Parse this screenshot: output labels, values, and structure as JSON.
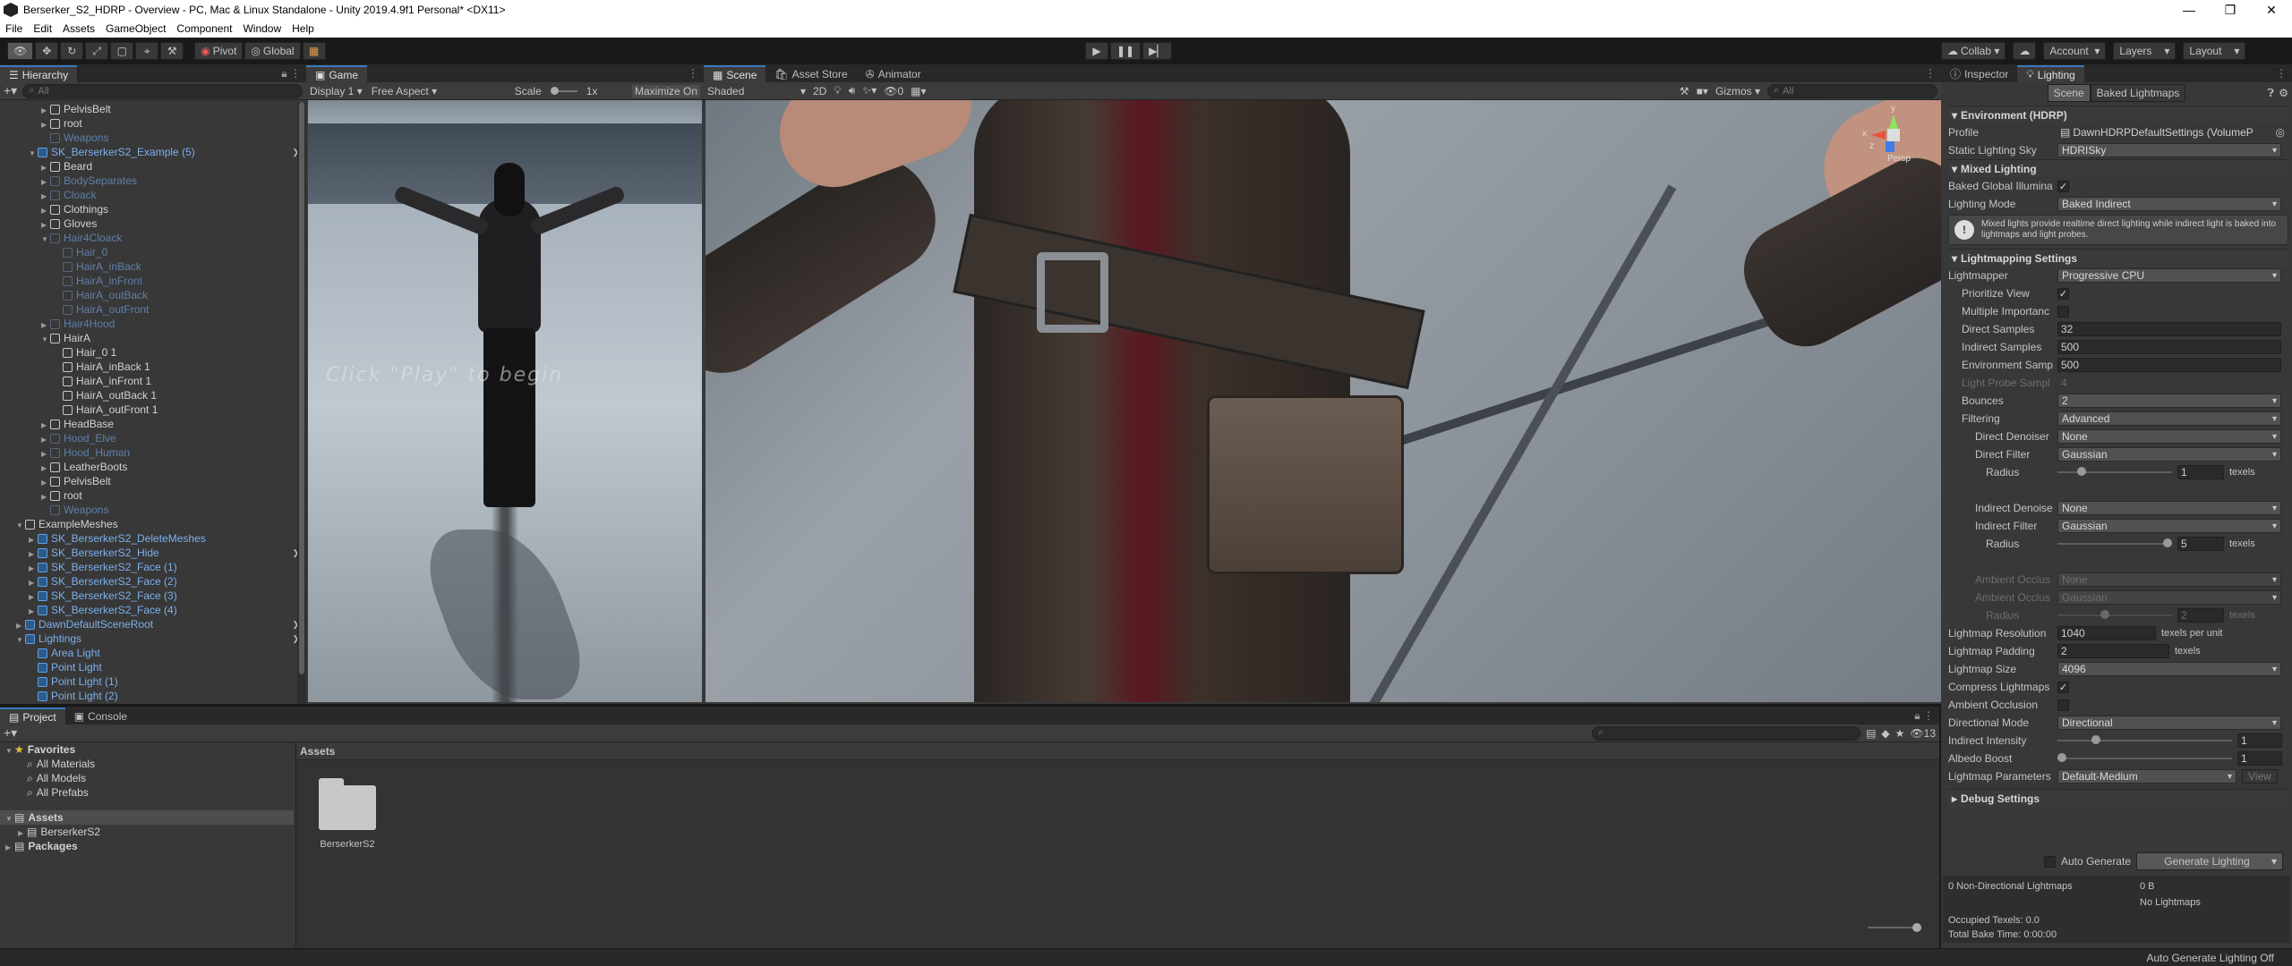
{
  "window": {
    "title": "Berserker_S2_HDRP - Overview - PC, Mac & Linux Standalone - Unity 2019.4.9f1 Personal* <DX11>",
    "controls": [
      "—",
      "❐",
      "✕"
    ]
  },
  "menu": [
    "File",
    "Edit",
    "Assets",
    "GameObject",
    "Component",
    "Window",
    "Help"
  ],
  "toolbar": {
    "pivot": "Pivot",
    "global": "Global",
    "collab": "Collab",
    "account": "Account",
    "layers": "Layers",
    "layout": "Layout"
  },
  "hierarchy": {
    "tab": "Hierarchy",
    "search_placeholder": "All",
    "rows": [
      {
        "label": "PelvisBelt",
        "indent": 4,
        "style": "",
        "arrow": "▶"
      },
      {
        "label": "root",
        "indent": 4,
        "style": "",
        "arrow": "▶"
      },
      {
        "label": "Weapons",
        "indent": 4,
        "style": "dim",
        "arrow": ""
      },
      {
        "label": "SK_BerserkerS2_Example (5)",
        "indent": 3,
        "style": "blue",
        "arrow": "▼",
        "more": true
      },
      {
        "label": "Beard",
        "indent": 4,
        "style": "",
        "arrow": "▶"
      },
      {
        "label": "BodySeparates",
        "indent": 4,
        "style": "dim",
        "arrow": "▶"
      },
      {
        "label": "Cloack",
        "indent": 4,
        "style": "dim",
        "arrow": "▶"
      },
      {
        "label": "Clothings",
        "indent": 4,
        "style": "",
        "arrow": "▶"
      },
      {
        "label": "Gloves",
        "indent": 4,
        "style": "",
        "arrow": "▶"
      },
      {
        "label": "Hair4Cloack",
        "indent": 4,
        "style": "dim",
        "arrow": "▼"
      },
      {
        "label": "Hair_0",
        "indent": 5,
        "style": "dim",
        "arrow": ""
      },
      {
        "label": "HairA_inBack",
        "indent": 5,
        "style": "dim",
        "arrow": ""
      },
      {
        "label": "HairA_inFront",
        "indent": 5,
        "style": "dim",
        "arrow": ""
      },
      {
        "label": "HairA_outBack",
        "indent": 5,
        "style": "dim",
        "arrow": ""
      },
      {
        "label": "HairA_outFront",
        "indent": 5,
        "style": "dim",
        "arrow": ""
      },
      {
        "label": "Hair4Hood",
        "indent": 4,
        "style": "dim",
        "arrow": "▶"
      },
      {
        "label": "HairA",
        "indent": 4,
        "style": "",
        "arrow": "▼"
      },
      {
        "label": "Hair_0 1",
        "indent": 5,
        "style": "",
        "arrow": ""
      },
      {
        "label": "HairA_inBack 1",
        "indent": 5,
        "style": "",
        "arrow": ""
      },
      {
        "label": "HairA_inFront 1",
        "indent": 5,
        "style": "",
        "arrow": ""
      },
      {
        "label": "HairA_outBack 1",
        "indent": 5,
        "style": "",
        "arrow": ""
      },
      {
        "label": "HairA_outFront 1",
        "indent": 5,
        "style": "",
        "arrow": ""
      },
      {
        "label": "HeadBase",
        "indent": 4,
        "style": "",
        "arrow": "▶"
      },
      {
        "label": "Hood_Elve",
        "indent": 4,
        "style": "dim",
        "arrow": "▶"
      },
      {
        "label": "Hood_Human",
        "indent": 4,
        "style": "dim",
        "arrow": "▶"
      },
      {
        "label": "LeatherBoots",
        "indent": 4,
        "style": "",
        "arrow": "▶"
      },
      {
        "label": "PelvisBelt",
        "indent": 4,
        "style": "",
        "arrow": "▶"
      },
      {
        "label": "root",
        "indent": 4,
        "style": "",
        "arrow": "▶"
      },
      {
        "label": "Weapons",
        "indent": 4,
        "style": "dim",
        "arrow": ""
      },
      {
        "label": "ExampleMeshes",
        "indent": 2,
        "style": "",
        "arrow": "▼"
      },
      {
        "label": "SK_BerserkerS2_DeleteMeshes",
        "indent": 3,
        "style": "blue",
        "arrow": "▶"
      },
      {
        "label": "SK_BerserkerS2_Hide",
        "indent": 3,
        "style": "blue",
        "arrow": "▶",
        "more": true
      },
      {
        "label": "SK_BerserkerS2_Face (1)",
        "indent": 3,
        "style": "blue",
        "arrow": "▶"
      },
      {
        "label": "SK_BerserkerS2_Face (2)",
        "indent": 3,
        "style": "blue",
        "arrow": "▶"
      },
      {
        "label": "SK_BerserkerS2_Face (3)",
        "indent": 3,
        "style": "blue",
        "arrow": "▶"
      },
      {
        "label": "SK_BerserkerS2_Face (4)",
        "indent": 3,
        "style": "blue",
        "arrow": "▶"
      },
      {
        "label": "DawnDefaultSceneRoot",
        "indent": 2,
        "style": "blue",
        "arrow": "▶",
        "more": true
      },
      {
        "label": "Lightings",
        "indent": 2,
        "style": "blue",
        "arrow": "▼",
        "more": true
      },
      {
        "label": "Area Light",
        "indent": 3,
        "style": "blue",
        "arrow": ""
      },
      {
        "label": "Point Light",
        "indent": 3,
        "style": "blue",
        "arrow": ""
      },
      {
        "label": "Point Light (1)",
        "indent": 3,
        "style": "blue",
        "arrow": ""
      },
      {
        "label": "Point Light (2)",
        "indent": 3,
        "style": "blue",
        "arrow": ""
      }
    ]
  },
  "game": {
    "tab": "Game",
    "display": "Display 1",
    "aspect": "Free Aspect",
    "scale_label": "Scale",
    "scale_value": "1x",
    "maximize": "Maximize On",
    "overlay": "Click \"Play\" to begin"
  },
  "scene": {
    "tabs": [
      "Scene",
      "Asset Store",
      "Animator"
    ],
    "shading": "Shaded",
    "mode2d": "2D",
    "gizmos": "Gizmos",
    "search": "All",
    "persp": "Persp",
    "axes": {
      "x": "x",
      "y": "y",
      "z": "z"
    }
  },
  "inspector": {
    "tabs": [
      "Inspector",
      "Lighting"
    ],
    "subtabs": [
      "Scene",
      "Baked Lightmaps"
    ],
    "env_header": "Environment (HDRP)",
    "profile_label": "Profile",
    "profile_value": "DawnHDRPDefaultSettings (VolumeP",
    "sky_label": "Static Lighting Sky",
    "sky_value": "HDRISky",
    "mixed_header": "Mixed Lighting",
    "bgi_label": "Baked Global Illumina",
    "lighting_mode_label": "Lighting Mode",
    "lighting_mode_value": "Baked Indirect",
    "info": "Mixed lights provide realtime direct lighting while indirect light is baked into lightmaps and light probes.",
    "lm_header": "Lightmapping Settings",
    "lightmapper_label": "Lightmapper",
    "lightmapper_value": "Progressive CPU",
    "prioritize_label": "Prioritize View",
    "multiple_label": "Multiple Importanc",
    "direct_samples_label": "Direct Samples",
    "direct_samples_value": "32",
    "indirect_samples_label": "Indirect Samples",
    "indirect_samples_value": "500",
    "env_samples_label": "Environment Samp",
    "env_samples_value": "500",
    "probe_label": "Light Probe Sampl",
    "probe_value": "4",
    "bounces_label": "Bounces",
    "bounces_value": "2",
    "filtering_label": "Filtering",
    "filtering_value": "Advanced",
    "direct_denoiser_label": "Direct Denoiser",
    "direct_denoiser_value": "None",
    "direct_filter_label": "Direct Filter",
    "direct_filter_value": "Gaussian",
    "radius_label": "Radius",
    "direct_radius_value": "1",
    "texels": "texels",
    "indirect_denoiser_label": "Indirect Denoise",
    "indirect_denoiser_value": "None",
    "indirect_filter_label": "Indirect Filter",
    "indirect_filter_value": "Gaussian",
    "indirect_radius_value": "5",
    "ao1_label": "Ambient Occlus",
    "ao1_value": "None",
    "ao2_label": "Ambient Occlus",
    "ao2_value": "Gaussian",
    "ao_radius_value": "2",
    "res_label": "Lightmap Resolution",
    "res_value": "1040",
    "res_unit": "texels per unit",
    "padding_label": "Lightmap Padding",
    "padding_value": "2",
    "size_label": "Lightmap Size",
    "size_value": "4096",
    "compress_label": "Compress Lightmaps",
    "ao_label": "Ambient Occlusion",
    "dir_mode_label": "Directional Mode",
    "dir_mode_value": "Directional",
    "ind_int_label": "Indirect Intensity",
    "ind_int_value": "1",
    "albedo_label": "Albedo Boost",
    "albedo_value": "1",
    "params_label": "Lightmap Parameters",
    "params_value": "Default-Medium",
    "view": "View",
    "debug_header": "Debug Settings",
    "auto_generate": "Auto Generate",
    "generate": "Generate Lighting",
    "stats": {
      "nondir": "0 Non-Directional Lightmaps",
      "bytes": "0 B",
      "nolm": "No Lightmaps",
      "occupied": "Occupied Texels: 0.0",
      "bake_time": "Total Bake Time: 0:00:00"
    }
  },
  "project": {
    "tabs": [
      "Project",
      "Console"
    ],
    "favorites": "Favorites",
    "fav_items": [
      "All Materials",
      "All Models",
      "All Prefabs"
    ],
    "assets": "Assets",
    "asset_children": [
      "BerserkerS2"
    ],
    "packages": "Packages",
    "breadcrumb": "Assets",
    "folder": "BerserkerS2",
    "count": "13"
  },
  "status": {
    "right": "Auto Generate Lighting Off"
  }
}
